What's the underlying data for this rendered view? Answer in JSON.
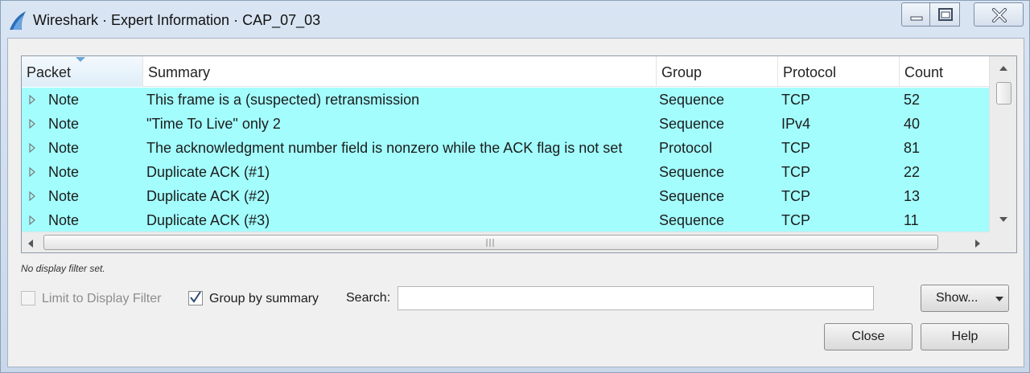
{
  "window": {
    "title": "Wireshark · Expert Information · CAP_07_03"
  },
  "columns": [
    "Packet",
    "Summary",
    "Group",
    "Protocol",
    "Count"
  ],
  "rows": [
    {
      "severity": "Note",
      "summary": "This frame is a (suspected) retransmission",
      "group": "Sequence",
      "protocol": "TCP",
      "count": "52"
    },
    {
      "severity": "Note",
      "summary": "\"Time To Live\" only 2",
      "group": "Sequence",
      "protocol": "IPv4",
      "count": "40"
    },
    {
      "severity": "Note",
      "summary": "The acknowledgment number field is nonzero while the ACK flag is not set",
      "group": "Protocol",
      "protocol": "TCP",
      "count": "81"
    },
    {
      "severity": "Note",
      "summary": "Duplicate ACK (#1)",
      "group": "Sequence",
      "protocol": "TCP",
      "count": "22"
    },
    {
      "severity": "Note",
      "summary": "Duplicate ACK (#2)",
      "group": "Sequence",
      "protocol": "TCP",
      "count": "13"
    },
    {
      "severity": "Note",
      "summary": "Duplicate ACK (#3)",
      "group": "Sequence",
      "protocol": "TCP",
      "count": "11"
    }
  ],
  "row_color": "#a3fdfd",
  "status": {
    "filter_note": "No display filter set."
  },
  "controls": {
    "limit_to_display_filter": {
      "label": "Limit to Display Filter",
      "checked": false,
      "enabled": false
    },
    "group_by_summary": {
      "label": "Group by summary",
      "checked": true,
      "enabled": true
    },
    "search_label": "Search:",
    "search_value": "",
    "show_button": "Show...",
    "close_button": "Close",
    "help_button": "Help"
  },
  "icons": {
    "app": "wireshark-fin-icon",
    "expander": "triangle-right-icon",
    "sort": "sort-descending-icon"
  }
}
